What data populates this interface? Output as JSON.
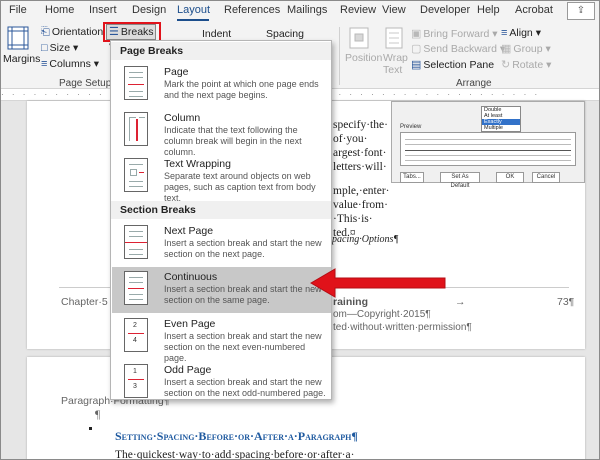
{
  "tabs": [
    {
      "label": "File",
      "active": false
    },
    {
      "label": "Home",
      "active": false
    },
    {
      "label": "Insert",
      "active": false
    },
    {
      "label": "Design",
      "active": false
    },
    {
      "label": "Layout",
      "active": true
    },
    {
      "label": "References",
      "active": false
    },
    {
      "label": "Mailings",
      "active": false
    },
    {
      "label": "Review",
      "active": false
    },
    {
      "label": "View",
      "active": false
    },
    {
      "label": "Developer",
      "active": false
    },
    {
      "label": "Help",
      "active": false
    },
    {
      "label": "Acrobat",
      "active": false
    }
  ],
  "ribbon": {
    "margins": "Margins",
    "orientation": "Orientation",
    "size": "Size",
    "columns": "Columns",
    "breaks": "Breaks",
    "indent": "Indent",
    "spacing": "Spacing",
    "page_setup_label": "Page Setup",
    "position": "Position",
    "wrap_text_1": "Wrap",
    "wrap_text_2": "Text",
    "bring_forward": "Bring Forward",
    "send_backward": "Send Backward",
    "selection_pane": "Selection Pane",
    "align": "Align",
    "group": "Group",
    "rotate": "Rotate",
    "arrange_label": "Arrange"
  },
  "menu": {
    "page_breaks_header": "Page Breaks",
    "section_breaks_header": "Section Breaks",
    "items": [
      {
        "title": "Page",
        "key": "P",
        "rest": "age",
        "desc": "Mark the point at which one page ends and the next page begins.",
        "selected": false
      },
      {
        "title": "Column",
        "key": "C",
        "rest": "olumn",
        "desc": "Indicate that the text following the column break will begin in the next column.",
        "selected": false
      },
      {
        "title": "Text Wrapping",
        "key": "T",
        "rest": "ext Wrapping",
        "desc": "Separate text around objects on web pages, such as caption text from body text.",
        "selected": false
      },
      {
        "title": "Next Page",
        "key": "N",
        "rest": "ext Page",
        "desc": "Insert a section break and start the new section on the next page.",
        "selected": false
      },
      {
        "title": "Continuous",
        "key": "O",
        "rest": "Continuous",
        "desc": "Insert a section break and start the new section on the same page.",
        "selected": true
      },
      {
        "title": "Even Page",
        "key": "E",
        "rest": "ven Page",
        "desc": "Insert a section break and start the new section on the next even-numbered page.",
        "selected": false
      },
      {
        "title": "Odd Page",
        "key": "D",
        "rest": "Odd Page",
        "desc": "Insert a section break and start the new section on the next odd-numbered page.",
        "selected": false
      }
    ]
  },
  "document": {
    "body_lines": [
      "specify·the·",
      "of·you·",
      "argest·font·",
      "letters·will·"
    ],
    "body_lines2": [
      "mple,·enter·",
      "value·from·",
      "·This·is·",
      "ted.¤"
    ],
    "caption": "Spacing·Options¶",
    "footer_left": "Chapter·5",
    "footer_center": "raining",
    "footer_arrow": "→",
    "footer_page": "73¶",
    "footer_line2": "om—Copyright·2015¶",
    "footer_line3": "ted·without·written·permission¶",
    "para_label": "Paragraph·Formatting¶",
    "pilcrow": "¶",
    "heading": "Setting·Spacing·Before·or·After·a·Paragraph¶",
    "body_last": "The·quickest·way·to·add·spacing·before·or·after·a·"
  },
  "dialog": {
    "preview_label": "Preview",
    "list_items": [
      "Double",
      "At least",
      "Exactly",
      "Multiple"
    ],
    "selected_list_item": "Exactly",
    "tabs_btn": "Tabs...",
    "default_btn": "Set As Default",
    "ok_btn": "OK",
    "cancel_btn": "Cancel"
  },
  "colors": {
    "accent": "#1c4e8c",
    "highlight_red": "#e0121a",
    "selected_item_bg": "#c8c8c8"
  }
}
